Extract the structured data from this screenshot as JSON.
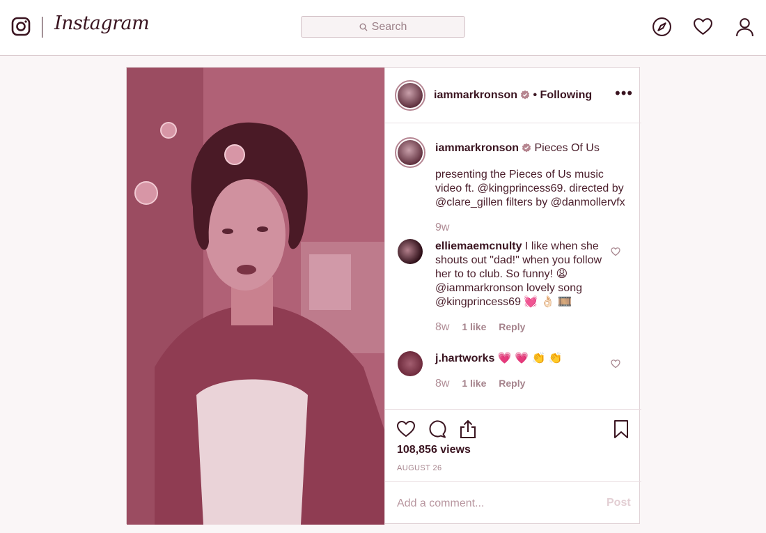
{
  "brand": {
    "wordmark": "Instagram",
    "logo_icon": "camera-glyph-icon"
  },
  "search": {
    "placeholder": "Search"
  },
  "nav": {
    "explore_icon": "compass-icon",
    "activity_icon": "heart-icon",
    "profile_icon": "person-icon"
  },
  "colors": {
    "accent": "#3a1420",
    "muted": "#a5838c",
    "tint": "#b86a80"
  },
  "post": {
    "author": {
      "username": "iammarkronson",
      "verified": true,
      "follow_state": "Following"
    },
    "caption": {
      "username": "iammarkronson",
      "title": "Pieces Of Us",
      "body": "presenting the Pieces of Us music video ft. @kingprincess69. directed by @clare_gillen filters by @danmollervfx",
      "time": "9w"
    },
    "comments": [
      {
        "username": "elliemaemcnulty",
        "text": "I like when she shouts out \"dad!\" when you follow her to to club. So funny! 😩 @iammarkronson lovely song @kingprincess69 💓 👌🏻 🎞️",
        "time": "8w",
        "likes": "1 like",
        "reply": "Reply"
      },
      {
        "username": "j.hartworks",
        "text": "💗 💗 👏 👏",
        "time": "8w",
        "likes": "1 like",
        "reply": "Reply"
      }
    ],
    "views": "108,856 views",
    "date": "AUGUST 26",
    "comment_box": {
      "placeholder": "Add a comment...",
      "post_label": "Post"
    }
  }
}
